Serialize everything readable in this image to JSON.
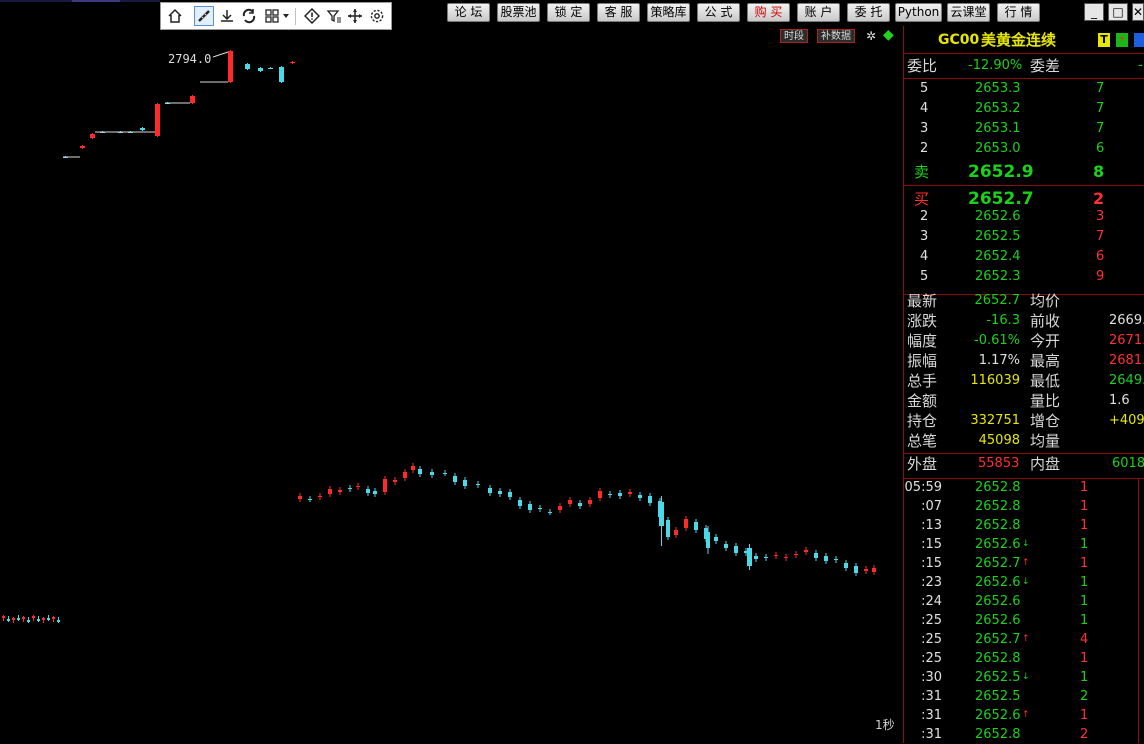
{
  "menu": [
    {
      "label": "论 坛"
    },
    {
      "label": "股票池"
    },
    {
      "label": "锁 定"
    },
    {
      "label": "客 服"
    },
    {
      "label": "策略库"
    },
    {
      "label": "公 式"
    },
    {
      "label": "购 买"
    },
    {
      "label": "账 户"
    },
    {
      "label": "委 托"
    },
    {
      "label": "Python"
    },
    {
      "label": "云课堂"
    },
    {
      "label": "行 情"
    }
  ],
  "window_controls": {
    "minimize": "_",
    "maximize": "□",
    "close": "✕"
  },
  "toolbar_icons": [
    "home-icon",
    "ruler-icon",
    "download-icon",
    "refresh-sync-icon",
    "grid-layout-icon",
    "dropdown-caret-icon",
    "alert-diamond-icon",
    "filter-icon",
    "move-arrows-icon",
    "settings-gear-icon"
  ],
  "chart": {
    "chips": {
      "period": "时段",
      "fill": "补数据"
    },
    "high_label": "2794.0",
    "footer_label": "1秒",
    "colors": {
      "up": "#ff2a2a",
      "down": "#4dd8e6",
      "bg": "#000000"
    }
  },
  "quote": {
    "code": "GC00",
    "name": "美黄金连续",
    "badge1": "T",
    "badge2": "⚡",
    "wei_bi_label": "委比",
    "wei_bi_value": "-12.90%",
    "wei_cha_label": "委差",
    "wei_cha_value": "-",
    "asks": [
      {
        "level": "5",
        "price": "2653.3",
        "vol": "7"
      },
      {
        "level": "4",
        "price": "2653.2",
        "vol": "7"
      },
      {
        "level": "3",
        "price": "2653.1",
        "vol": "7"
      },
      {
        "level": "2",
        "price": "2653.0",
        "vol": "6"
      }
    ],
    "ask1": {
      "level": "卖",
      "price": "2652.9",
      "vol": "8"
    },
    "bid1": {
      "level": "买",
      "price": "2652.7",
      "vol": "2"
    },
    "bids": [
      {
        "level": "2",
        "price": "2652.6",
        "vol": "3"
      },
      {
        "level": "3",
        "price": "2652.5",
        "vol": "7"
      },
      {
        "level": "4",
        "price": "2652.4",
        "vol": "6"
      },
      {
        "level": "5",
        "price": "2652.3",
        "vol": "9"
      }
    ],
    "stats": [
      {
        "l1": "最新",
        "v1": "2652.7",
        "c1": "green",
        "l2": "均价",
        "v2": "",
        "c2": "white"
      },
      {
        "l1": "涨跌",
        "v1": "-16.3",
        "c1": "green",
        "l2": "前收",
        "v2": "2669.",
        "c2": "white"
      },
      {
        "l1": "幅度",
        "v1": "-0.61%",
        "c1": "green",
        "l2": "今开",
        "v2": "2671.",
        "c2": "red"
      },
      {
        "l1": "振幅",
        "v1": "1.17%",
        "c1": "white",
        "l2": "最高",
        "v2": "2681.",
        "c2": "red"
      },
      {
        "l1": "总手",
        "v1": "116039",
        "c1": "yellow",
        "l2": "最低",
        "v2": "2649.",
        "c2": "green"
      },
      {
        "l1": "金额",
        "v1": "",
        "c1": "white",
        "l2": "量比",
        "v2": "1.6",
        "c2": "white"
      },
      {
        "l1": "持仓",
        "v1": "332751",
        "c1": "yellow",
        "l2": "增仓",
        "v2": "+409",
        "c2": "yellow"
      },
      {
        "l1": "总笔",
        "v1": "45098",
        "c1": "yellow",
        "l2": "均量",
        "v2": "",
        "c2": "white"
      }
    ],
    "outer_label": "外盘",
    "outer_value": "55853",
    "inner_label": "内盘",
    "inner_value": "6018",
    "ticks": [
      {
        "time": "05:59",
        "price": "2652.8",
        "arrow": "",
        "vol": "1",
        "vc": "red"
      },
      {
        "time": ":07",
        "price": "2652.8",
        "arrow": "",
        "vol": "1",
        "vc": "red"
      },
      {
        "time": ":13",
        "price": "2652.8",
        "arrow": "",
        "vol": "1",
        "vc": "red"
      },
      {
        "time": ":15",
        "price": "2652.6",
        "arrow": "↓",
        "vol": "1",
        "vc": "green"
      },
      {
        "time": ":15",
        "price": "2652.7",
        "arrow": "↑",
        "vol": "1",
        "vc": "red"
      },
      {
        "time": ":23",
        "price": "2652.6",
        "arrow": "↓",
        "vol": "1",
        "vc": "green"
      },
      {
        "time": ":24",
        "price": "2652.6",
        "arrow": "",
        "vol": "1",
        "vc": "green"
      },
      {
        "time": ":25",
        "price": "2652.6",
        "arrow": "",
        "vol": "1",
        "vc": "green"
      },
      {
        "time": ":25",
        "price": "2652.7",
        "arrow": "↑",
        "vol": "4",
        "vc": "red"
      },
      {
        "time": ":25",
        "price": "2652.8",
        "arrow": "",
        "vol": "1",
        "vc": "red"
      },
      {
        "time": ":30",
        "price": "2652.5",
        "arrow": "↓",
        "vol": "1",
        "vc": "green"
      },
      {
        "time": ":31",
        "price": "2652.5",
        "arrow": "",
        "vol": "2",
        "vc": "green"
      },
      {
        "time": ":31",
        "price": "2652.6",
        "arrow": "↑",
        "vol": "1",
        "vc": "red"
      },
      {
        "time": ":31",
        "price": "2652.8",
        "arrow": "",
        "vol": "2",
        "vc": "red"
      }
    ]
  }
}
